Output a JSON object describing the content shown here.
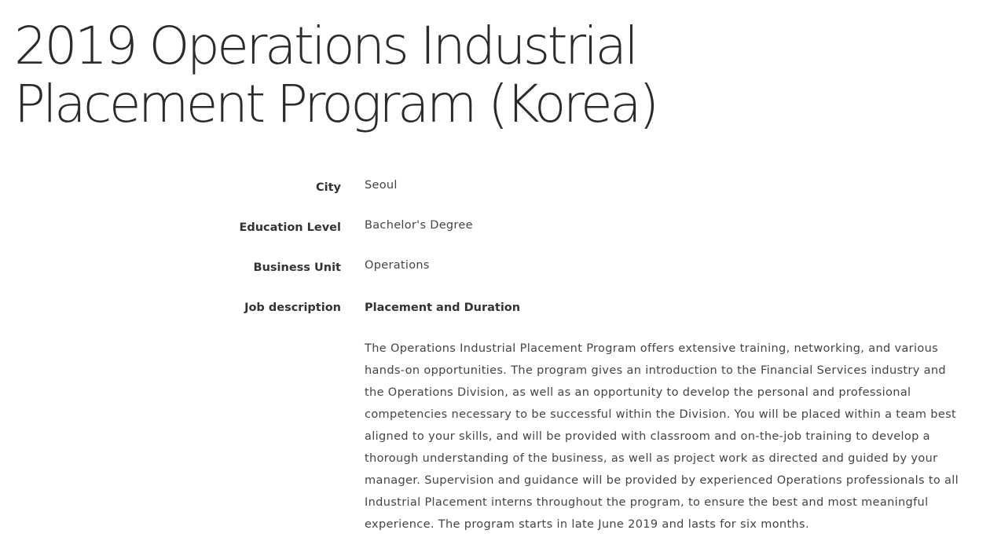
{
  "job": {
    "title": "2019 Operations Industrial Placement Program (Korea)",
    "fields": [
      {
        "label": "City",
        "value": "Seoul"
      },
      {
        "label": "Education Level",
        "value": "Bachelor's Degree"
      },
      {
        "label": "Business Unit",
        "value": "Operations"
      }
    ],
    "description": {
      "label": "Job description",
      "heading": "Placement and Duration",
      "body": "The Operations Industrial Placement Program offers extensive training, networking, and various hands-on opportunities. The program gives an introduction to the Financial Services industry and the Operations Division, as well as an opportunity to develop the personal and professional competencies necessary to be successful within the Division. You will be placed within a team best aligned to your skills, and will be provided with classroom and on-the-job training to develop a thorough understanding of the business, as well as project work as directed and guided by your manager. Supervision and guidance will be provided by experienced Operations professionals to all Industrial Placement interns throughout the program, to ensure the best and most meaningful experience. The program starts in late June 2019 and lasts for six months."
    }
  }
}
